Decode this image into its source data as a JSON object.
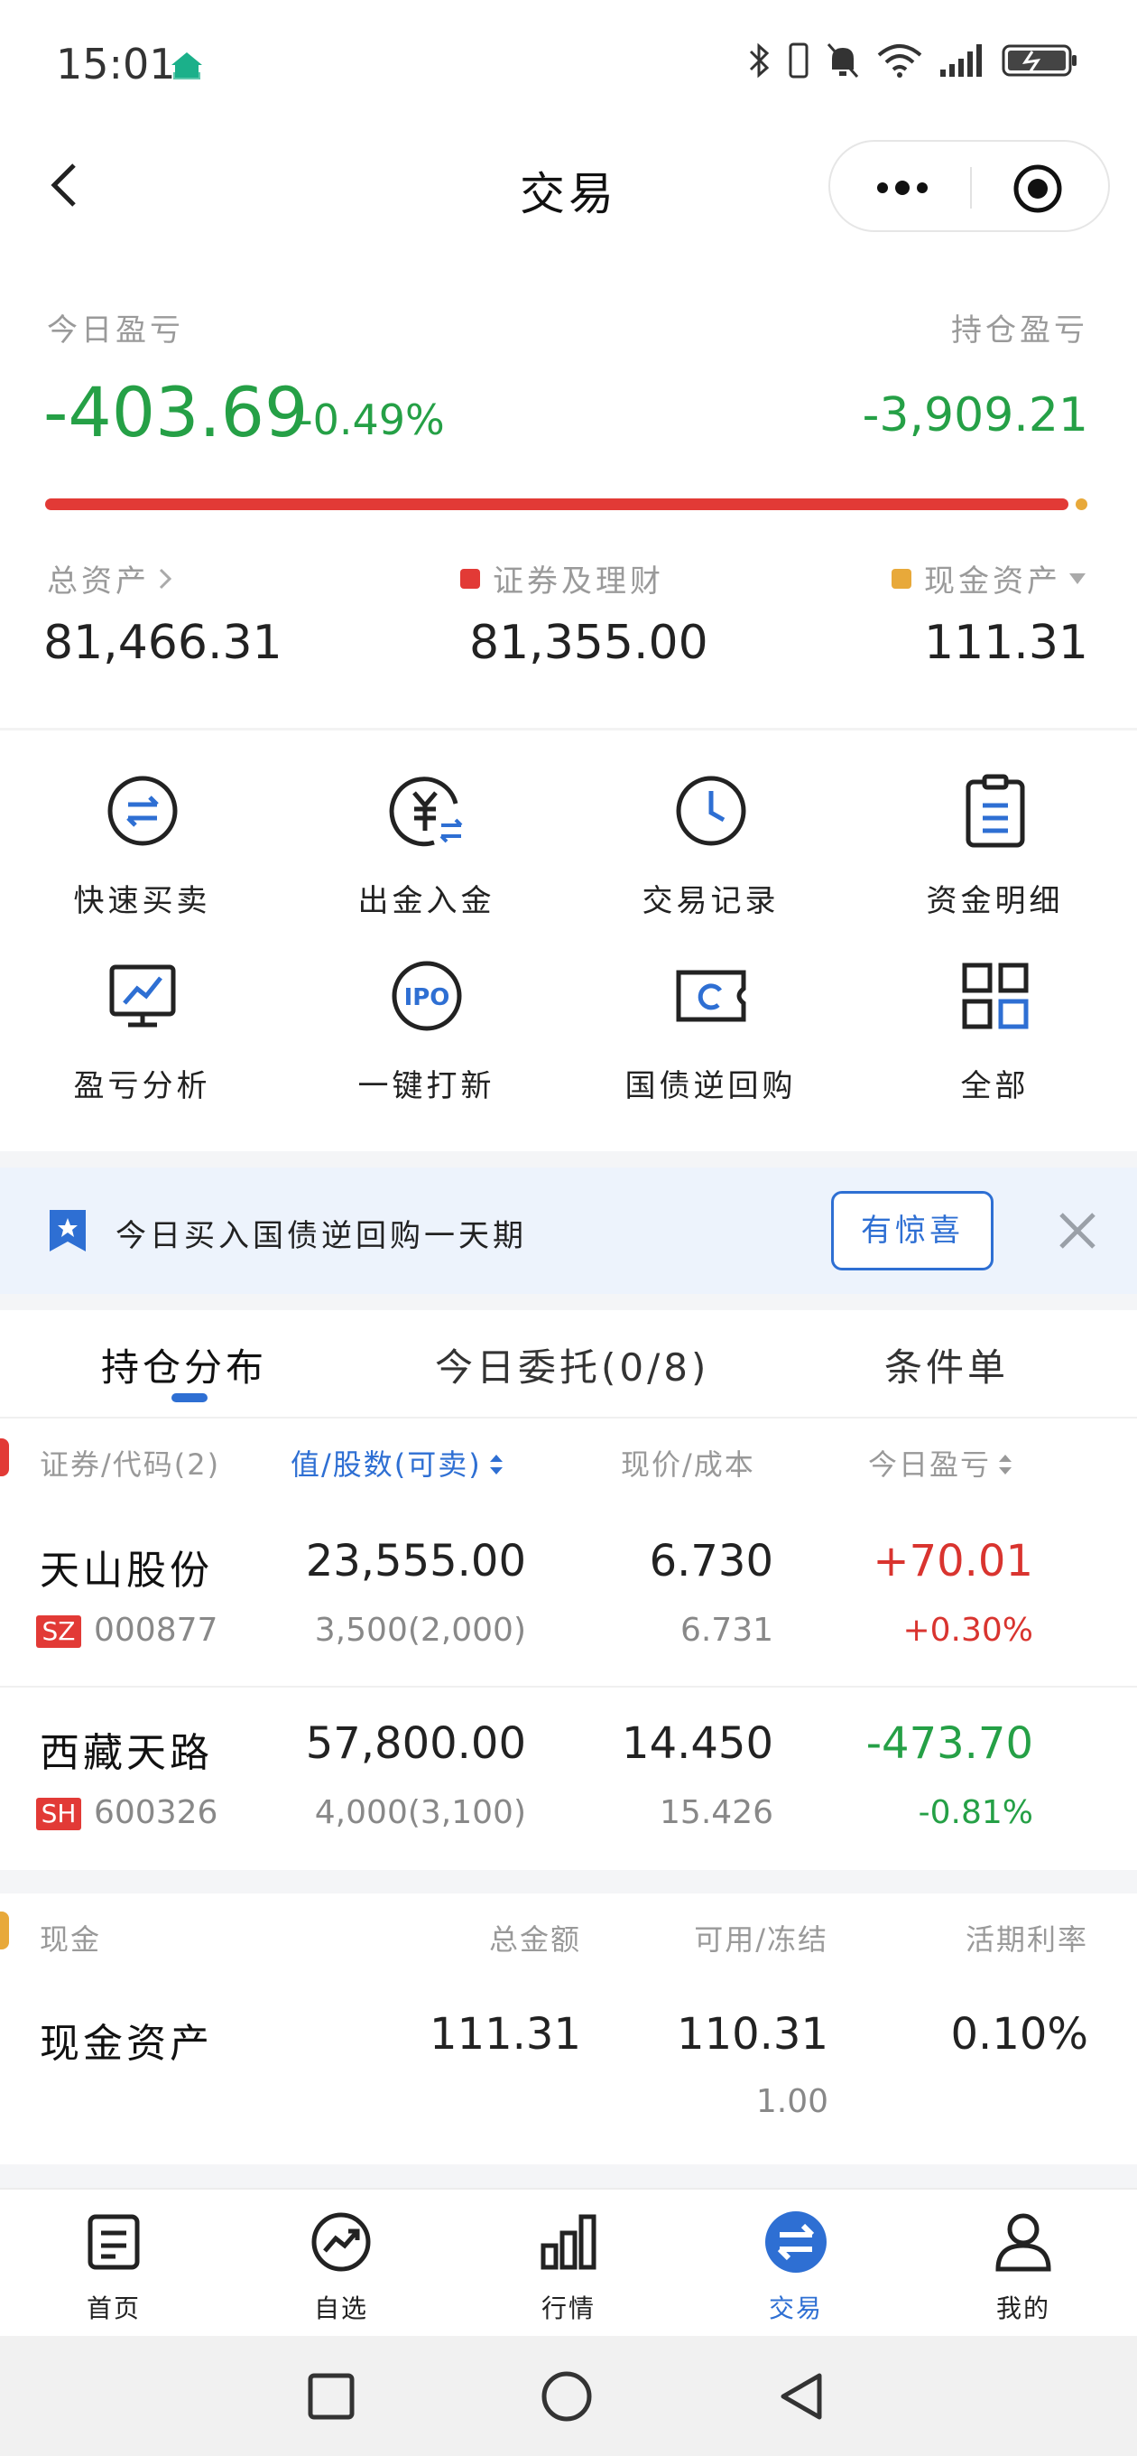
{
  "status_bar": {
    "time": "15:01",
    "icons": [
      "bluetooth-icon",
      "vibrate-icon",
      "mute-icon",
      "wifi-icon",
      "signal-icon",
      "battery-charging-icon"
    ]
  },
  "nav": {
    "title": "交易"
  },
  "pnl": {
    "today_label": "今日盈亏",
    "today_value": "-403.69",
    "today_percent": "-0.49%",
    "holding_label": "持仓盈亏",
    "holding_value": "-3,909.21",
    "securities_share": 0.9986
  },
  "assets": {
    "total_label": "总资产",
    "total_value": "81,466.31",
    "securities_label": "证券及理财",
    "securities_value": "81,355.00",
    "cash_label": "现金资产",
    "cash_value": "111.31"
  },
  "grid": [
    {
      "label": "快速买卖",
      "icon": "swap-circle-icon"
    },
    {
      "label": "出金入金",
      "icon": "yuan-transfer-icon"
    },
    {
      "label": "交易记录",
      "icon": "clock-icon"
    },
    {
      "label": "资金明细",
      "icon": "clipboard-icon"
    },
    {
      "label": "盈亏分析",
      "icon": "chart-monitor-icon"
    },
    {
      "label": "一键打新",
      "icon": "ipo-icon"
    },
    {
      "label": "国债逆回购",
      "icon": "ticket-icon"
    },
    {
      "label": "全部",
      "icon": "grid-icon"
    }
  ],
  "banner": {
    "text": "今日买入国债逆回购一天期",
    "button": "有惊喜"
  },
  "tabs": [
    "持仓分布",
    "今日委托(0/8)",
    "条件单"
  ],
  "holdings": {
    "headers": [
      "证券/代码(2)",
      "值/股数(可卖)",
      "现价/成本",
      "今日盈亏"
    ],
    "rows": [
      {
        "name": "天山股份",
        "market": "SZ",
        "code": "000877",
        "value": "23,555.00",
        "qty": "3,500(2,000)",
        "price": "6.730",
        "cost": "6.731",
        "pnl": "+70.01",
        "pnl_pct": "+0.30%"
      },
      {
        "name": "西藏天路",
        "market": "SH",
        "code": "600326",
        "value": "57,800.00",
        "qty": "4,000(3,100)",
        "price": "14.450",
        "cost": "15.426",
        "pnl": "-473.70",
        "pnl_pct": "-0.81%"
      }
    ]
  },
  "cash": {
    "headers": [
      "现金",
      "总金额",
      "可用/冻结",
      "活期利率"
    ],
    "name": "现金资产",
    "total": "111.31",
    "available": "110.31",
    "frozen": "1.00",
    "rate": "0.10%"
  },
  "tabbar": [
    {
      "label": "首页",
      "icon": "home-doc-icon"
    },
    {
      "label": "自选",
      "icon": "trend-icon"
    },
    {
      "label": "行情",
      "icon": "bar-chart-icon"
    },
    {
      "label": "交易",
      "icon": "trade-icon",
      "active": true
    },
    {
      "label": "我的",
      "icon": "person-icon"
    }
  ],
  "colors": {
    "brand_blue": "#2e6fd3",
    "loss_green": "#25a046",
    "gain_red": "#d9342f",
    "cash_gold": "#e8a93a"
  }
}
